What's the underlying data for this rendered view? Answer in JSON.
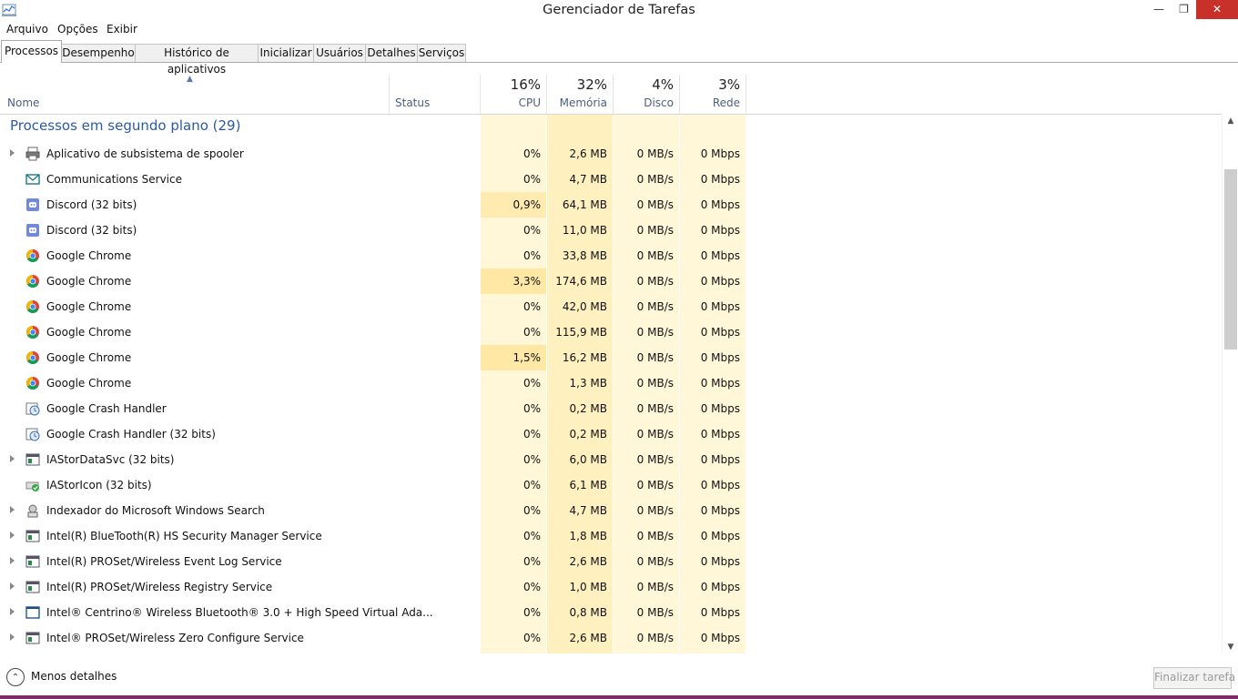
{
  "window": {
    "title": "Gerenciador de Tarefas",
    "controls": [
      "minimize-icon",
      "restore-icon",
      "close-icon"
    ],
    "icon": "task-manager-icon"
  },
  "menu": [
    "Arquivo",
    "Opções",
    "Exibir"
  ],
  "tabs": [
    {
      "label": "Processos",
      "active": true
    },
    {
      "label": "Desempenho"
    },
    {
      "label": "Histórico de aplicativos"
    },
    {
      "label": "Inicializar"
    },
    {
      "label": "Usuários"
    },
    {
      "label": "Detalhes"
    },
    {
      "label": "Serviços"
    }
  ],
  "columns": {
    "name": "Nome",
    "status": "Status",
    "cpu": {
      "label": "CPU",
      "pct": "16%"
    },
    "mem": {
      "label": "Memória",
      "pct": "32%"
    },
    "disk": {
      "label": "Disco",
      "pct": "4%"
    },
    "net": {
      "label": "Rede",
      "pct": "3%"
    }
  },
  "group": {
    "title": "Processos em segundo plano (29)"
  },
  "rows": [
    {
      "name": "Aplicativo de subsistema de spooler",
      "icon": "printer-icon",
      "expand": true,
      "cpu": "0%",
      "mem": "2,6 MB",
      "disk": "0 MB/s",
      "net": "0 Mbps"
    },
    {
      "name": "Communications Service",
      "icon": "mail-icon",
      "expand": false,
      "cpu": "0%",
      "mem": "4,7 MB",
      "disk": "0 MB/s",
      "net": "0 Mbps"
    },
    {
      "name": "Discord (32 bits)",
      "icon": "discord-icon",
      "expand": false,
      "cpu": "0,9%",
      "mem": "64,1 MB",
      "disk": "0 MB/s",
      "net": "0 Mbps"
    },
    {
      "name": "Discord (32 bits)",
      "icon": "discord-icon",
      "expand": false,
      "cpu": "0%",
      "mem": "11,0 MB",
      "disk": "0 MB/s",
      "net": "0 Mbps"
    },
    {
      "name": "Google Chrome",
      "icon": "chrome-icon",
      "expand": false,
      "cpu": "0%",
      "mem": "33,8 MB",
      "disk": "0 MB/s",
      "net": "0 Mbps"
    },
    {
      "name": "Google Chrome",
      "icon": "chrome-icon",
      "expand": false,
      "cpu": "3,3%",
      "mem": "174,6 MB",
      "disk": "0 MB/s",
      "net": "0 Mbps"
    },
    {
      "name": "Google Chrome",
      "icon": "chrome-icon",
      "expand": false,
      "cpu": "0%",
      "mem": "42,0 MB",
      "disk": "0 MB/s",
      "net": "0 Mbps"
    },
    {
      "name": "Google Chrome",
      "icon": "chrome-icon",
      "expand": false,
      "cpu": "0%",
      "mem": "115,9 MB",
      "disk": "0 MB/s",
      "net": "0 Mbps"
    },
    {
      "name": "Google Chrome",
      "icon": "chrome-icon",
      "expand": false,
      "cpu": "1,5%",
      "mem": "16,2 MB",
      "disk": "0 MB/s",
      "net": "0 Mbps"
    },
    {
      "name": "Google Chrome",
      "icon": "chrome-icon",
      "expand": false,
      "cpu": "0%",
      "mem": "1,3 MB",
      "disk": "0 MB/s",
      "net": "0 Mbps"
    },
    {
      "name": "Google Crash Handler",
      "icon": "crash-handler-icon",
      "expand": false,
      "cpu": "0%",
      "mem": "0,2 MB",
      "disk": "0 MB/s",
      "net": "0 Mbps"
    },
    {
      "name": "Google Crash Handler (32 bits)",
      "icon": "crash-handler-icon",
      "expand": false,
      "cpu": "0%",
      "mem": "0,2 MB",
      "disk": "0 MB/s",
      "net": "0 Mbps"
    },
    {
      "name": "IAStorDataSvc (32 bits)",
      "icon": "service-window-icon",
      "expand": true,
      "cpu": "0%",
      "mem": "6,0 MB",
      "disk": "0 MB/s",
      "net": "0 Mbps"
    },
    {
      "name": "IAStorIcon (32 bits)",
      "icon": "storage-check-icon",
      "expand": false,
      "cpu": "0%",
      "mem": "6,1 MB",
      "disk": "0 MB/s",
      "net": "0 Mbps"
    },
    {
      "name": "Indexador do Microsoft Windows Search",
      "icon": "search-indexer-icon",
      "expand": true,
      "cpu": "0%",
      "mem": "4,7 MB",
      "disk": "0 MB/s",
      "net": "0 Mbps"
    },
    {
      "name": "Intel(R) BlueTooth(R) HS Security Manager Service",
      "icon": "service-window-icon",
      "expand": true,
      "cpu": "0%",
      "mem": "1,8 MB",
      "disk": "0 MB/s",
      "net": "0 Mbps"
    },
    {
      "name": "Intel(R) PROSet/Wireless Event Log Service",
      "icon": "service-window-icon",
      "expand": true,
      "cpu": "0%",
      "mem": "2,6 MB",
      "disk": "0 MB/s",
      "net": "0 Mbps"
    },
    {
      "name": "Intel(R) PROSet/Wireless Registry Service",
      "icon": "service-window-icon",
      "expand": true,
      "cpu": "0%",
      "mem": "1,0 MB",
      "disk": "0 MB/s",
      "net": "0 Mbps"
    },
    {
      "name": "Intel® Centrino® Wireless Bluetooth® 3.0 + High Speed Virtual Ada...",
      "icon": "blank-window-icon",
      "expand": true,
      "cpu": "0%",
      "mem": "0,8 MB",
      "disk": "0 MB/s",
      "net": "0 Mbps"
    },
    {
      "name": "Intel® PROSet/Wireless Zero Configure Service",
      "icon": "service-window-icon",
      "expand": true,
      "cpu": "0%",
      "mem": "2,6 MB",
      "disk": "0 MB/s",
      "net": "0 Mbps"
    }
  ],
  "footer": {
    "less_details": "Menos detalhes",
    "end_task": "Finalizar tarefa"
  },
  "colors": {
    "shade_light": "#fff7d8",
    "shade_mid": "#fff0c0",
    "shade_high": "#ffe7a6",
    "header_blue": "#2a5aa6",
    "close_red": "#c7312a"
  }
}
